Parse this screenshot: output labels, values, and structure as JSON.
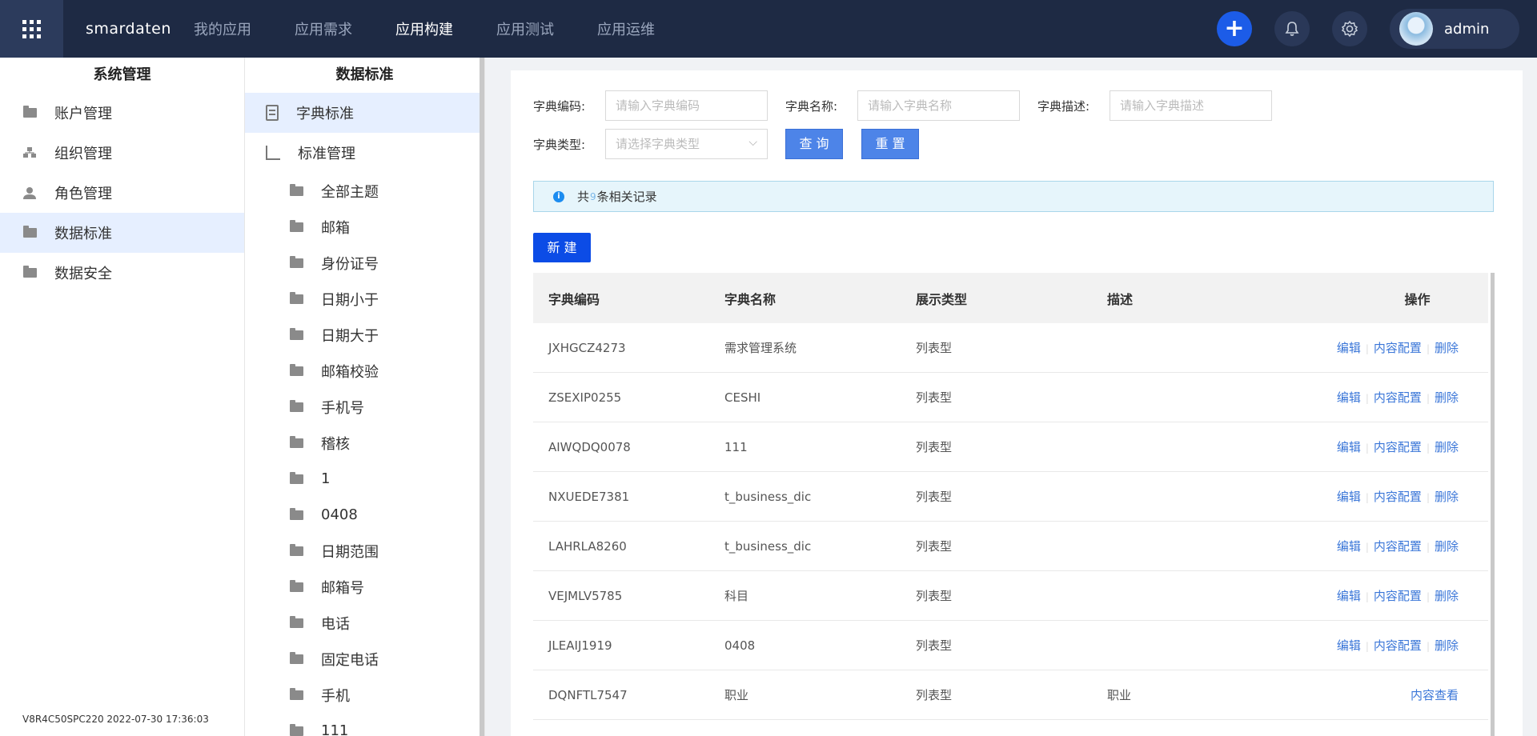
{
  "header": {
    "brand": "smardaten",
    "nav": [
      "我的应用",
      "应用需求",
      "应用构建",
      "应用测试",
      "应用运维"
    ],
    "username": "admin"
  },
  "sidebar": {
    "title": "系统管理",
    "items": [
      {
        "label": "账户管理",
        "icon": "folder-icon"
      },
      {
        "label": "组织管理",
        "icon": "org-icon"
      },
      {
        "label": "角色管理",
        "icon": "user-icon"
      },
      {
        "label": "数据标准",
        "icon": "folder-icon"
      },
      {
        "label": "数据安全",
        "icon": "folder-icon"
      }
    ],
    "version": "V8R4C50SPC220 2022-07-30 17:36:03"
  },
  "midpanel": {
    "title": "数据标准",
    "items": [
      "字典标准",
      "标准管理"
    ],
    "subitems": [
      "全部主题",
      "邮箱",
      "身份证号",
      "日期小于",
      "日期大于",
      "邮箱校验",
      "手机号",
      "稽核",
      "1",
      "0408",
      "日期范围",
      "邮箱号",
      "电话",
      "固定电话",
      "手机",
      "111"
    ]
  },
  "filters": {
    "code_label": "字典编码:",
    "code_placeholder": "请输入字典编码",
    "name_label": "字典名称:",
    "name_placeholder": "请输入字典名称",
    "desc_label": "字典描述:",
    "desc_placeholder": "请输入字典描述",
    "type_label": "字典类型:",
    "type_placeholder": "请选择字典类型",
    "query_btn": "查 询",
    "reset_btn": "重 置"
  },
  "info": {
    "prefix": "共",
    "count": "9",
    "suffix": "条相关记录"
  },
  "new_btn": "新 建",
  "table": {
    "columns": [
      "字典编码",
      "字典名称",
      "展示类型",
      "描述",
      "操作"
    ],
    "actions": {
      "edit": "编辑",
      "config": "内容配置",
      "delete": "删除",
      "view": "内容查看"
    },
    "rows": [
      {
        "code": "JXHGCZ4273",
        "name": "需求管理系统",
        "type": "列表型",
        "desc": "",
        "mode": "edit"
      },
      {
        "code": "ZSEXIP0255",
        "name": "CESHI",
        "type": "列表型",
        "desc": "",
        "mode": "edit"
      },
      {
        "code": "AIWQDQ0078",
        "name": "111",
        "type": "列表型",
        "desc": "",
        "mode": "edit"
      },
      {
        "code": "NXUEDE7381",
        "name": "t_business_dic",
        "type": "列表型",
        "desc": "",
        "mode": "edit"
      },
      {
        "code": "LAHRLA8260",
        "name": "t_business_dic",
        "type": "列表型",
        "desc": "",
        "mode": "edit"
      },
      {
        "code": "VEJMLV5785",
        "name": "科目",
        "type": "列表型",
        "desc": "",
        "mode": "edit"
      },
      {
        "code": "JLEAIJ1919",
        "name": "0408",
        "type": "列表型",
        "desc": "",
        "mode": "edit"
      },
      {
        "code": "DQNFTL7547",
        "name": "职业",
        "type": "列表型",
        "desc": "职业",
        "mode": "view"
      }
    ]
  }
}
